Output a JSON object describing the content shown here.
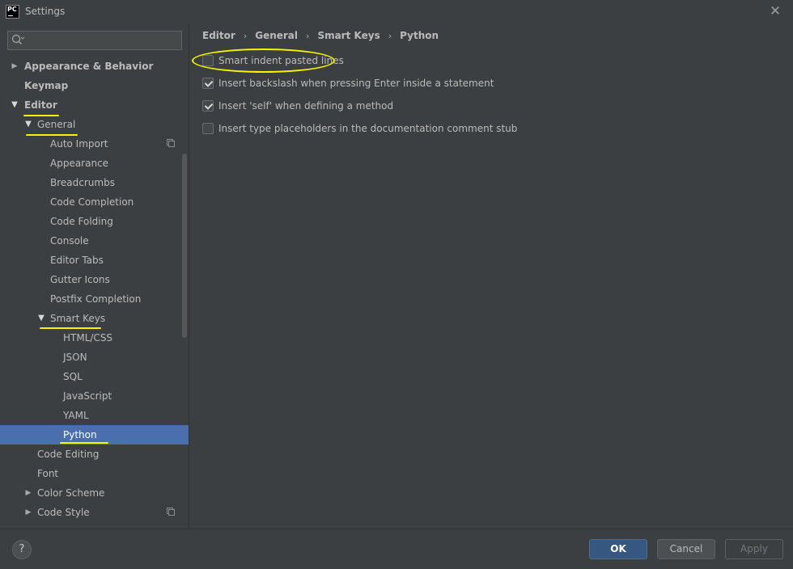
{
  "window": {
    "title": "Settings",
    "logo_text": "PC",
    "close_glyph": "✕"
  },
  "search": {
    "placeholder": "",
    "value": ""
  },
  "tree": {
    "appearance_behavior": "Appearance & Behavior",
    "keymap": "Keymap",
    "editor": "Editor",
    "general": "General",
    "auto_import": "Auto Import",
    "appearance": "Appearance",
    "breadcrumbs": "Breadcrumbs",
    "code_completion": "Code Completion",
    "code_folding": "Code Folding",
    "console": "Console",
    "editor_tabs": "Editor Tabs",
    "gutter_icons": "Gutter Icons",
    "postfix_completion": "Postfix Completion",
    "smart_keys": "Smart Keys",
    "html_css": "HTML/CSS",
    "json": "JSON",
    "sql": "SQL",
    "javascript": "JavaScript",
    "yaml": "YAML",
    "python": "Python",
    "code_editing": "Code Editing",
    "font": "Font",
    "color_scheme": "Color Scheme",
    "code_style": "Code Style"
  },
  "breadcrumb": {
    "items": [
      "Editor",
      "General",
      "Smart Keys",
      "Python"
    ],
    "separator": "›"
  },
  "options": [
    {
      "label": "Smart indent pasted lines",
      "checked": false
    },
    {
      "label": "Insert backslash when pressing Enter inside a statement",
      "checked": true
    },
    {
      "label": "Insert 'self' when defining a method",
      "checked": true
    },
    {
      "label": "Insert type placeholders in the documentation comment stub",
      "checked": false
    }
  ],
  "footer": {
    "help": "?",
    "ok": "OK",
    "cancel": "Cancel",
    "apply": "Apply"
  },
  "colors": {
    "background": "#3c3f41",
    "selection": "#4b6eaf",
    "primary_button": "#365880",
    "annotation": "#f5f500"
  },
  "icons": {
    "expanded": "triangle-down-icon",
    "collapsed": "triangle-right-icon",
    "project_scope": "copy-icon"
  }
}
